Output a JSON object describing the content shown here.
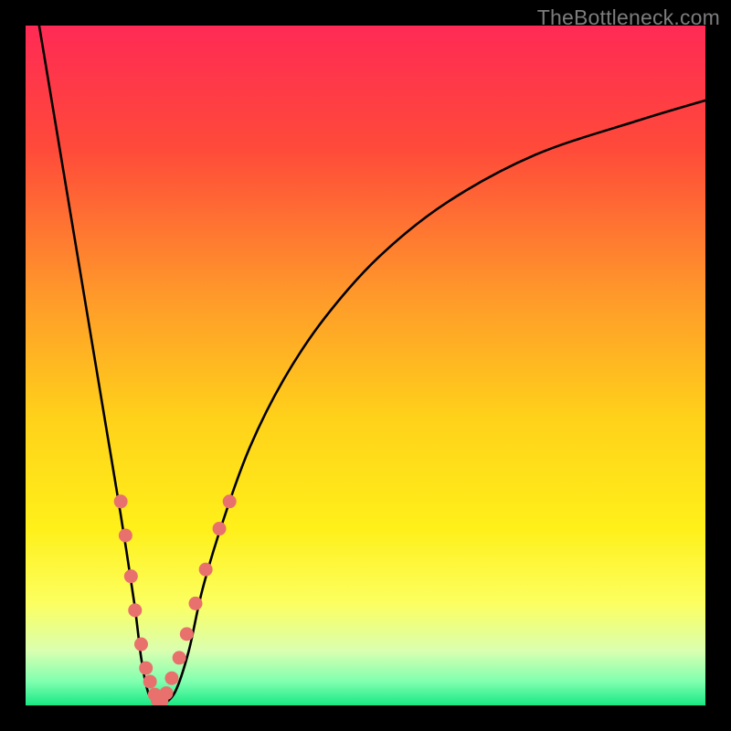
{
  "watermark": "TheBottleneck.com",
  "colors": {
    "background": "#000000",
    "gradient_stops": [
      {
        "offset": 0.0,
        "color": "#ff2a55"
      },
      {
        "offset": 0.18,
        "color": "#ff4a3a"
      },
      {
        "offset": 0.4,
        "color": "#ff9a2a"
      },
      {
        "offset": 0.58,
        "color": "#ffd21a"
      },
      {
        "offset": 0.74,
        "color": "#fff01a"
      },
      {
        "offset": 0.85,
        "color": "#fcff60"
      },
      {
        "offset": 0.92,
        "color": "#d9ffb0"
      },
      {
        "offset": 0.965,
        "color": "#80ffb0"
      },
      {
        "offset": 1.0,
        "color": "#18e884"
      }
    ],
    "curve": "#000000",
    "dots": "#e9716d"
  },
  "chart_data": {
    "type": "line",
    "title": "",
    "xlabel": "",
    "ylabel": "",
    "xlim": [
      0,
      100
    ],
    "ylim": [
      0,
      100
    ],
    "series": [
      {
        "name": "bottleneck-curve",
        "x": [
          2,
          4,
          6,
          8,
          10,
          12,
          14,
          16,
          17,
          18,
          19,
          19.5,
          20,
          22,
          24,
          26,
          29,
          33,
          38,
          44,
          52,
          62,
          75,
          90,
          100
        ],
        "y": [
          100,
          88,
          76,
          64,
          52,
          40,
          28,
          15,
          7,
          2,
          0.5,
          0,
          0,
          2,
          8,
          17,
          27,
          38,
          48,
          57,
          66,
          74,
          81,
          86,
          89
        ]
      }
    ],
    "dots": {
      "name": "markers",
      "points": [
        {
          "x": 14.0,
          "y": 30.0
        },
        {
          "x": 14.7,
          "y": 25.0
        },
        {
          "x": 15.5,
          "y": 19.0
        },
        {
          "x": 16.1,
          "y": 14.0
        },
        {
          "x": 17.0,
          "y": 9.0
        },
        {
          "x": 17.7,
          "y": 5.5
        },
        {
          "x": 18.3,
          "y": 3.5
        },
        {
          "x": 19.0,
          "y": 1.6
        },
        {
          "x": 19.4,
          "y": 0.8
        },
        {
          "x": 19.7,
          "y": 0.3
        },
        {
          "x": 20.0,
          "y": 0.6
        },
        {
          "x": 20.7,
          "y": 1.8
        },
        {
          "x": 21.5,
          "y": 4.0
        },
        {
          "x": 22.6,
          "y": 7.0
        },
        {
          "x": 23.7,
          "y": 10.5
        },
        {
          "x": 25.0,
          "y": 15.0
        },
        {
          "x": 26.5,
          "y": 20.0
        },
        {
          "x": 28.5,
          "y": 26.0
        },
        {
          "x": 30.0,
          "y": 30.0
        }
      ]
    }
  }
}
